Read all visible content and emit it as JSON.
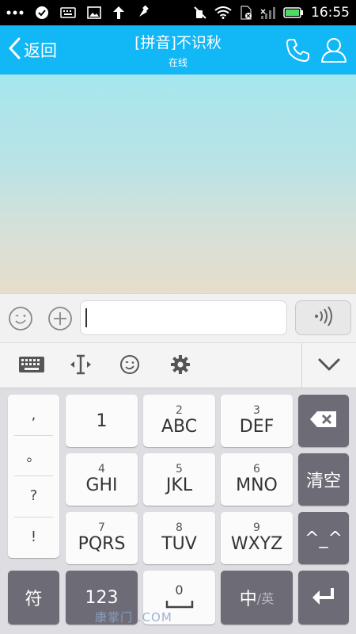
{
  "status_bar": {
    "time": "16:55",
    "icons": [
      "more-dots-icon",
      "check-circle-icon",
      "keyboard-icon",
      "image-icon",
      "upload-arrow-icon",
      "pin-icon",
      "mute-icon",
      "wifi-icon",
      "sim-icon",
      "signal-icon",
      "battery-icon"
    ]
  },
  "header": {
    "back_label": "返回",
    "title": "[拼音]不识秋",
    "status": "在线"
  },
  "input": {
    "value": "",
    "placeholder": ""
  },
  "keyboard": {
    "punctuation": [
      ",",
      "。",
      "?",
      "!"
    ],
    "keys": [
      {
        "num": "",
        "main": "1"
      },
      {
        "num": "2",
        "main": "ABC"
      },
      {
        "num": "3",
        "main": "DEF"
      },
      {
        "num": "4",
        "main": "GHI"
      },
      {
        "num": "5",
        "main": "JKL"
      },
      {
        "num": "6",
        "main": "MNO"
      },
      {
        "num": "7",
        "main": "PQRS"
      },
      {
        "num": "8",
        "main": "TUV"
      },
      {
        "num": "9",
        "main": "WXYZ"
      }
    ],
    "clear_label": "清空",
    "emoticon_label": "^_^",
    "symbol_label": "符",
    "num_switch_label": "123",
    "space_num": "0",
    "lang_main": "中",
    "lang_alt": "/英"
  },
  "watermark": "康掌门          .COM",
  "colors": {
    "header_bg": "#12b7f5",
    "dark_key": "#6d6c76",
    "keyboard_bg": "#dedee2"
  }
}
